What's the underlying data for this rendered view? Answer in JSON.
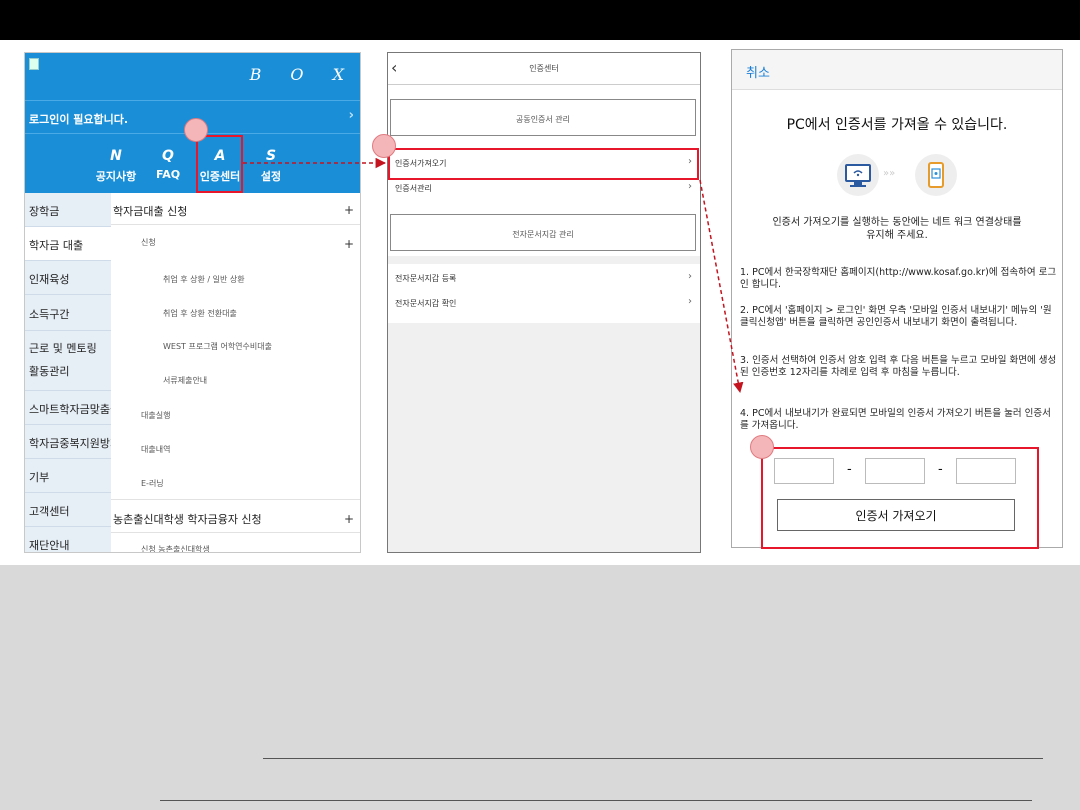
{
  "panel1": {
    "brand": "B O X",
    "login_text": "로그인이 필요합니다.",
    "login_arrow": "›",
    "menu": [
      {
        "letter": "N",
        "label": "공지사항"
      },
      {
        "letter": "Q",
        "label": "FAQ"
      },
      {
        "letter": "A",
        "label": "인증센터"
      },
      {
        "letter": "S",
        "label": "설정"
      }
    ],
    "sidebar": [
      "장학금",
      "학자금 대출",
      "인재육성",
      "소득구간",
      "근로 및 멘토링",
      "활동관리",
      "스마트학자금맞춤설계",
      "학자금중복지원방지",
      "기부",
      "고객센터",
      "재단안내"
    ],
    "content": {
      "loan_apply": "학자금대출 신청",
      "apply": "신청",
      "sub1": "취업 후 상환 / 일반 상환",
      "sub2": "취업 후 상환 전환대출",
      "sub3": "WEST 프로그램 어학연수비대출",
      "sub4": "서류제출안내",
      "status": "대출실행",
      "history": "대출내역",
      "elearning": "E-러닝",
      "rural": "농촌출신대학생 학자금융자 신청",
      "rural_apply": "신청 농촌출신대학생",
      "plus": "+"
    }
  },
  "panel2": {
    "back": "‹",
    "title": "인증센터",
    "public_cert": "공동인증서 관리",
    "import": "인증서가져오기",
    "manage": "인증서관리",
    "wallet": "전자문서지갑 관리",
    "wallet_register": "전자문서지갑 등록",
    "wallet_check": "전자문서지갑 확인",
    "chevron": "›"
  },
  "panel3": {
    "cancel": "취소",
    "title": "PC에서 인증서를 가져올 수  있습니다.",
    "desc": "인증서 가져오기를 실행하는 동안에는 네트 워크 연결상태를 유지해 주세요.",
    "step1": "1. PC에서 한국장학재단 홈페이지(http://www.kosaf.go.kr)에 접속하여 로그인 합니다.",
    "step2": "2. PC에서 '홈페이지 > 로그인' 화면 우측 '모바일 인증서 내보내기' 메뉴의 '원클릭신청앱' 버튼을 클릭하면 공인인증서 내보내기 화면이 출력됩니다.",
    "step3": "3. 인증서 선택하여 인증서 암호 입력 후 다음 버튼을 누르고 모바일 화면에 생성된 인증번호 12자리를 차례로 입력 후 마침을 누릅니다.",
    "step4": "4. PC에서 내보내기가 완료되면 모바일의 인증서 가져오기 버튼을 눌러 인증서를 가져옵니다.",
    "dash": "-",
    "code1": "",
    "code2": "",
    "code3": "",
    "button": "인증서 가져오기"
  },
  "colors": {
    "header_blue": "#1a8fd8",
    "highlight_red": "#e8162a",
    "marker_pink": "#f4b6b8"
  }
}
